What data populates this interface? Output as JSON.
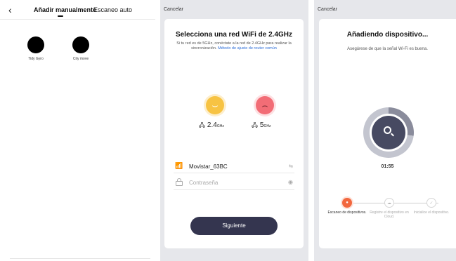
{
  "panel1": {
    "back_icon": "chevron-left-icon",
    "tabs": [
      {
        "label": "Añadir manualmente",
        "active": true
      },
      {
        "label": "Escaneo auto",
        "active": false
      }
    ],
    "devices": [
      {
        "name": "Tidy Gyro"
      },
      {
        "name": "City move"
      }
    ]
  },
  "panel2": {
    "cancel_label": "Cancelar",
    "title": "Selecciona una red WiFi de 2.4GHz",
    "description": "Si tu red es de 5GHz, conéctate a la red de 2.4GHz para realizar la sincronización.",
    "link_text": "Método de ajuste de router común",
    "bands": [
      {
        "value": "2.4",
        "unit": "GHz",
        "face": "smile-icon",
        "color": "#f7c343"
      },
      {
        "value": "5",
        "unit": "GHz",
        "face": "frown-icon",
        "color": "#f26d76"
      }
    ],
    "wifi_name": "Movistar_63BC",
    "password_placeholder": "Contraseña",
    "next_label": "Siguiente"
  },
  "panel3": {
    "cancel_label": "Cancelar",
    "title": "Añadiendo dispositivo...",
    "subtitle": "Asegúrese de que la señal Wi-Fi es buena.",
    "timer": "01:55",
    "progress": 0.27,
    "steps": [
      {
        "label": "Escaneo de dispositivos.",
        "status": "active"
      },
      {
        "label": "Registre el dispositivo en Cloud.",
        "status": "pending"
      },
      {
        "label": "Inicialice el dispositivo.",
        "status": "pending"
      }
    ]
  },
  "colors": {
    "accent_dark": "#34354f",
    "link": "#2a6bd6",
    "active_step": "#f2673e",
    "page_gray": "#e6e7eb"
  }
}
